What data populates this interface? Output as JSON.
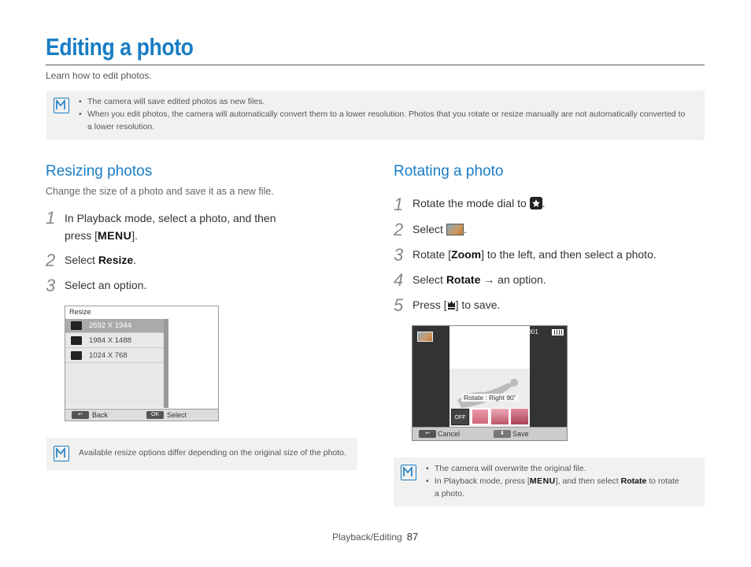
{
  "page": {
    "title": "Editing a photo",
    "subtitle": "Learn how to edit photos."
  },
  "top_note": {
    "icon": "note-icon",
    "items": [
      "The camera will save edited photos as new files.",
      "When you edit photos, the camera will automatically convert them to a lower resolution. Photos that you rotate or resize manually are not automatically converted to",
      "a lower resolution."
    ]
  },
  "resizing": {
    "heading": "Resizing photos",
    "description": "Change the size of a photo and save it as a new file.",
    "steps": [
      {
        "num": "1",
        "line1": "In Playback mode, select a photo, and then",
        "line2_pre": "press [",
        "key": "MENU",
        "line2_post": "]."
      },
      {
        "num": "2",
        "pre": "Select ",
        "key": "Resize",
        "post": "."
      },
      {
        "num": "3",
        "text": "Select an option."
      }
    ],
    "screen": {
      "title": "Resize",
      "options": [
        "2592 X 1944",
        "1984 X 1488",
        "1024 X 768"
      ],
      "back_label": "Back",
      "select_label": "Select",
      "ok_chip": "OK"
    },
    "note": "Available resize options differ depending on the original size of the photo."
  },
  "rotating": {
    "heading": "Rotating a photo",
    "steps": [
      {
        "num": "1",
        "pre": "Rotate the mode dial to ",
        "post": "."
      },
      {
        "num": "2",
        "pre": "Select ",
        "post": "."
      },
      {
        "num": "3",
        "pre": "Rotate [",
        "key": "Zoom",
        "post": "] to the left, and then select a photo."
      },
      {
        "num": "4",
        "pre": "Select ",
        "key": "Rotate",
        "arrow": " → ",
        "post": "an option."
      },
      {
        "num": "5",
        "pre": "Press [",
        "post": "] to save."
      }
    ],
    "screen": {
      "file_number": "100-0001",
      "rotate_label": "Rotate : Right 90˚",
      "off_label": "OFF",
      "cancel_label": "Cancel",
      "save_label": "Save"
    },
    "note_items": [
      "The camera will overwrite the original file.",
      {
        "pre": "In Playback mode, press [",
        "key": "MENU",
        "mid": "], and then select ",
        "key2": "Rotate",
        "post": " to rotate"
      },
      "a photo."
    ]
  },
  "footer": {
    "section": "Playback/Editing",
    "page_number": "87"
  },
  "colors": {
    "accent": "#1a7dc4",
    "note_bg": "#f1f1ef"
  }
}
